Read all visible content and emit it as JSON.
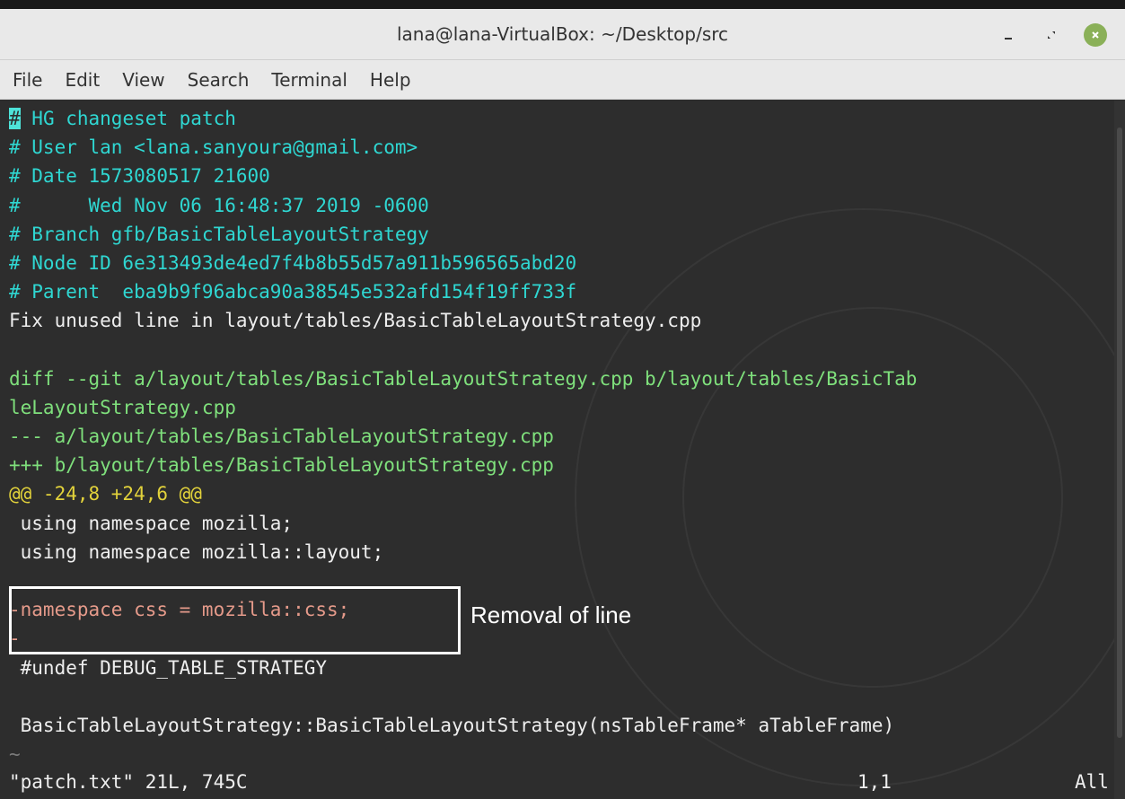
{
  "window": {
    "title": "lana@lana-VirtualBox: ~/Desktop/src"
  },
  "menubar": {
    "items": [
      "File",
      "Edit",
      "View",
      "Search",
      "Terminal",
      "Help"
    ]
  },
  "editor": {
    "lines": [
      {
        "text": "# HG changeset patch",
        "kind": "comment"
      },
      {
        "text": "# User lan <lana.sanyoura@gmail.com>",
        "kind": "comment"
      },
      {
        "text": "# Date 1573080517 21600",
        "kind": "comment"
      },
      {
        "text": "#      Wed Nov 06 16:48:37 2019 -0600",
        "kind": "comment"
      },
      {
        "text": "# Branch gfb/BasicTableLayoutStrategy",
        "kind": "comment"
      },
      {
        "text": "# Node ID 6e313493de4ed7f4b8b55d57a911b596565abd20",
        "kind": "comment"
      },
      {
        "text": "# Parent  eba9b9f96abca90a38545e532afd154f19ff733f",
        "kind": "comment"
      },
      {
        "text": "Fix unused line in layout/tables/BasicTableLayoutStrategy.cpp",
        "kind": "plain"
      },
      {
        "text": "",
        "kind": "plain"
      },
      {
        "text": "diff --git a/layout/tables/BasicTableLayoutStrategy.cpp b/layout/tables/BasicTab",
        "kind": "diff"
      },
      {
        "text": "leLayoutStrategy.cpp",
        "kind": "diff"
      },
      {
        "text": "--- a/layout/tables/BasicTableLayoutStrategy.cpp",
        "kind": "diff"
      },
      {
        "text": "+++ b/layout/tables/BasicTableLayoutStrategy.cpp",
        "kind": "diff"
      },
      {
        "text": "@@ -24,8 +24,6 @@",
        "kind": "hunk"
      },
      {
        "text": " using namespace mozilla;",
        "kind": "plain"
      },
      {
        "text": " using namespace mozilla::layout;",
        "kind": "plain"
      },
      {
        "text": "",
        "kind": "plain"
      },
      {
        "text": "-namespace css = mozilla::css;",
        "kind": "removed"
      },
      {
        "text": "-",
        "kind": "removed"
      },
      {
        "text": " #undef DEBUG_TABLE_STRATEGY",
        "kind": "plain"
      },
      {
        "text": "",
        "kind": "plain"
      },
      {
        "text": " BasicTableLayoutStrategy::BasicTableLayoutStrategy(nsTableFrame* aTableFrame)",
        "kind": "plain"
      },
      {
        "text": "~",
        "kind": "tilde"
      }
    ]
  },
  "annotation": {
    "label": "Removal of line"
  },
  "statusline": {
    "file_info": "\"patch.txt\" 21L, 745C",
    "position": "1,1",
    "scroll": "All"
  },
  "colors": {
    "comment": "#2fd7d2",
    "diff": "#7fe07c",
    "hunk": "#e2d23b",
    "removed": "#e59a8a",
    "plain": "#eeeeee",
    "close_button": "#8ab058"
  },
  "icons": {
    "minimize": "minimize-icon",
    "maximize": "maximize-icon",
    "close": "close-icon"
  }
}
